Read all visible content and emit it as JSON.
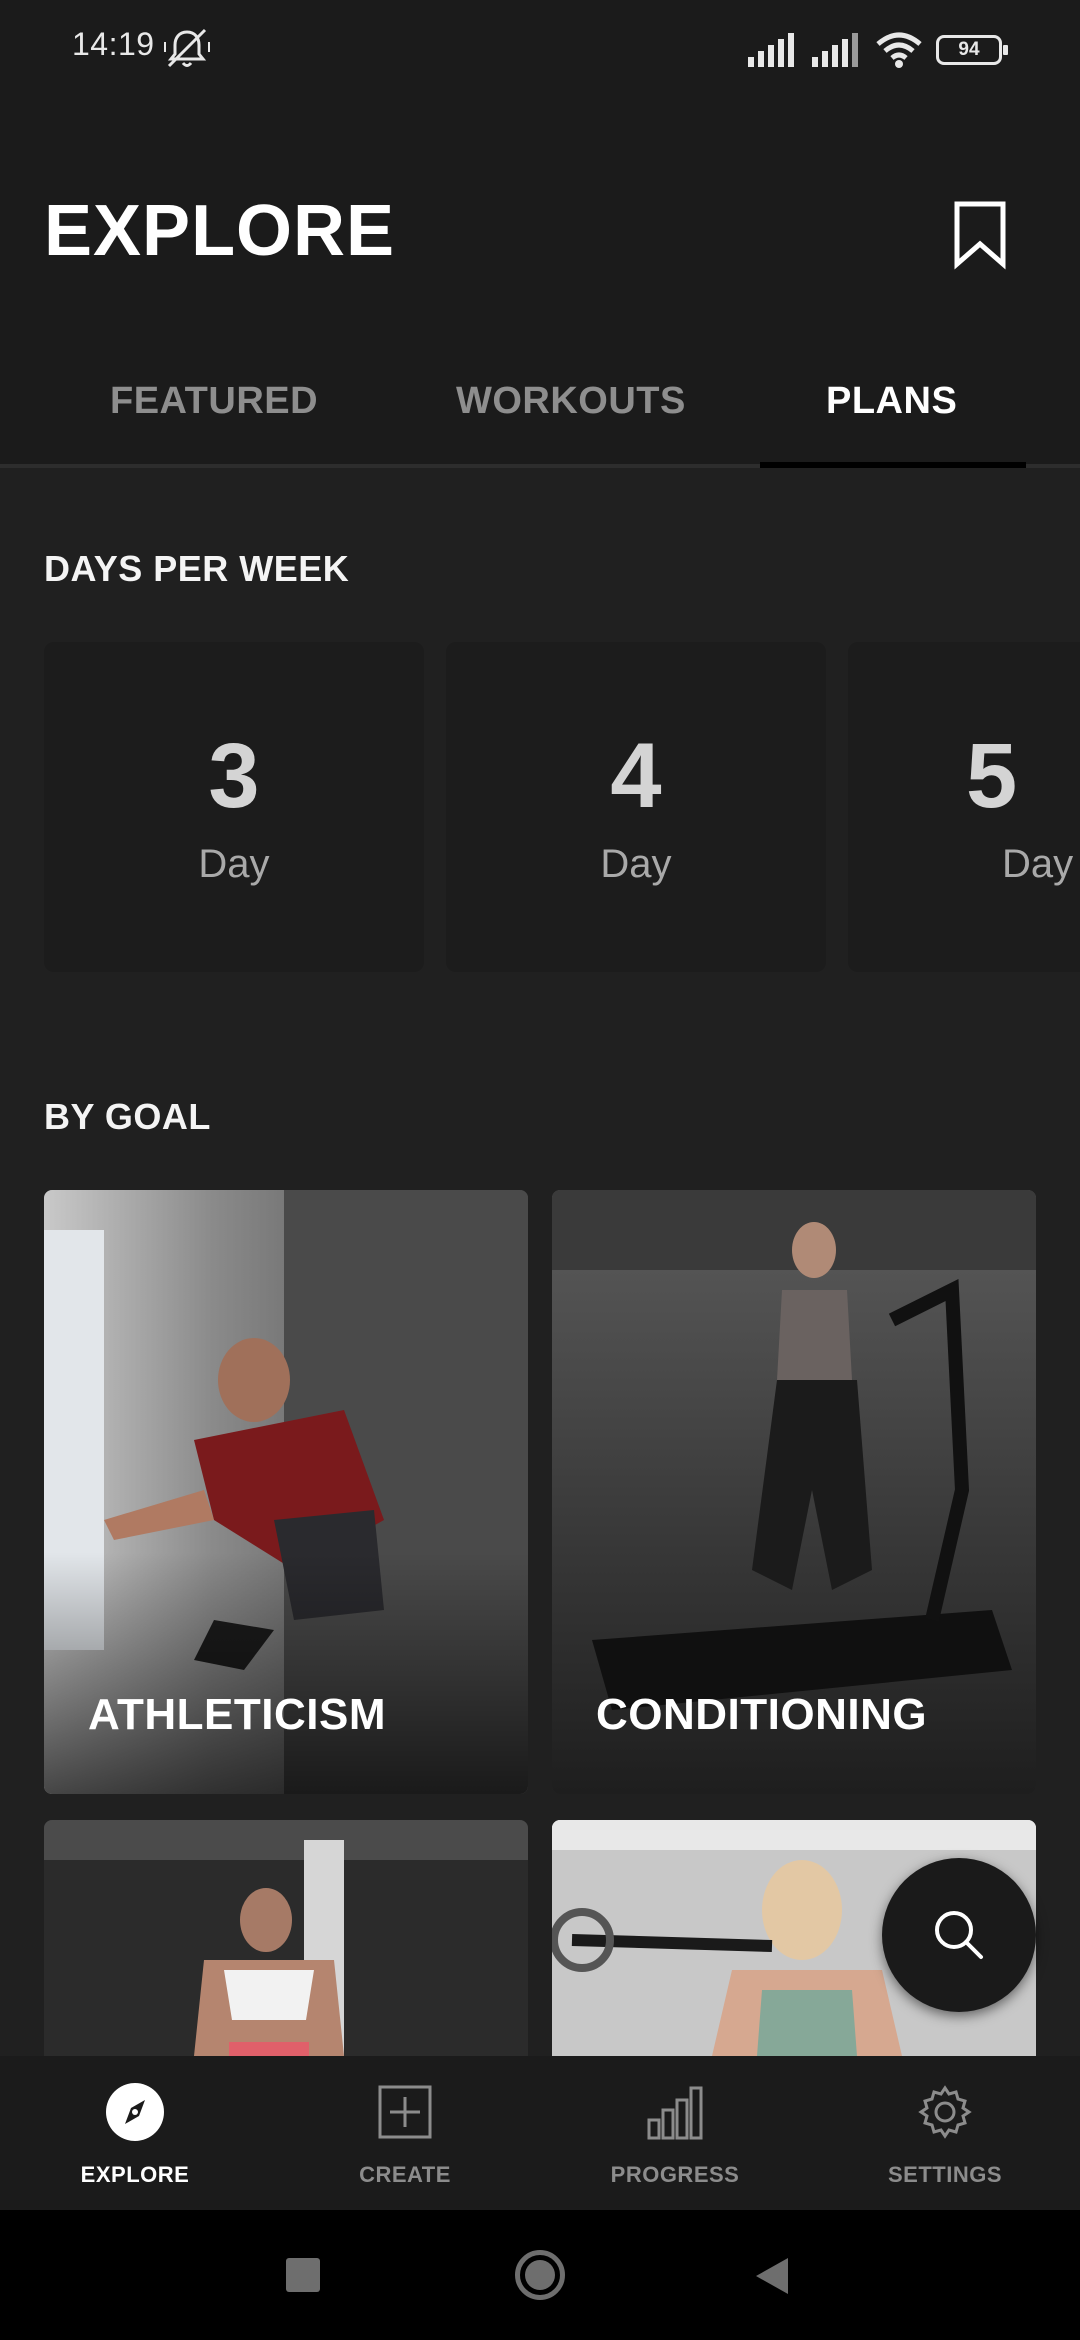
{
  "status_bar": {
    "time": "14:19",
    "battery": "94"
  },
  "header": {
    "title": "EXPLORE"
  },
  "tabs": [
    {
      "label": "FEATURED",
      "active": false
    },
    {
      "label": "WORKOUTS",
      "active": false
    },
    {
      "label": "PLANS",
      "active": true
    }
  ],
  "days_per_week": {
    "title": "DAYS PER WEEK",
    "cards": [
      {
        "number": "3",
        "unit": "Day"
      },
      {
        "number": "4",
        "unit": "Day"
      },
      {
        "number": "5",
        "unit": "Day"
      }
    ]
  },
  "by_goal": {
    "title": "BY GOAL",
    "cards": [
      {
        "label": "ATHLETICISM"
      },
      {
        "label": "CONDITIONING"
      },
      {
        "label": ""
      },
      {
        "label": ""
      }
    ]
  },
  "bottom_nav": [
    {
      "label": "EXPLORE",
      "icon": "compass-icon",
      "active": true
    },
    {
      "label": "CREATE",
      "icon": "plus-square-icon",
      "active": false
    },
    {
      "label": "PROGRESS",
      "icon": "bar-chart-icon",
      "active": false
    },
    {
      "label": "SETTINGS",
      "icon": "gear-icon",
      "active": false
    }
  ],
  "colors": {
    "background": "#202020",
    "card": "#1c1c1c",
    "accent": "#ffffff",
    "muted": "#8e8e8e"
  }
}
